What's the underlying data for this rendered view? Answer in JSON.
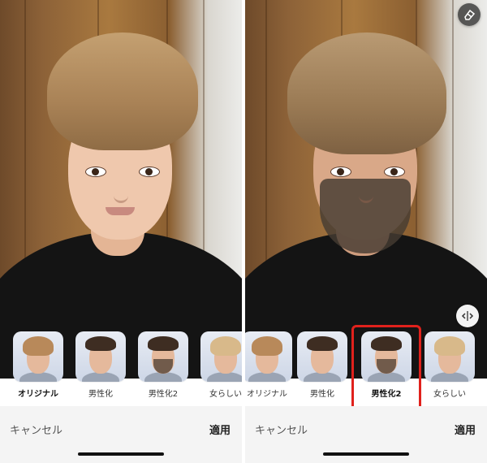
{
  "left_panel": {
    "filters": [
      {
        "label": "オリジナル",
        "selected": true
      },
      {
        "label": "男性化",
        "selected": false
      },
      {
        "label": "男性化2",
        "selected": false
      },
      {
        "label": "女らしい",
        "selected": false
      }
    ],
    "bottom_bar": {
      "cancel_label": "キャンセル",
      "apply_label": "適用"
    }
  },
  "right_panel": {
    "filters": [
      {
        "label": "オリジナル",
        "selected": false
      },
      {
        "label": "男性化",
        "selected": false
      },
      {
        "label": "男性化2",
        "selected": true
      },
      {
        "label": "女らしい",
        "selected": false
      }
    ],
    "bottom_bar": {
      "cancel_label": "キャンセル",
      "apply_label": "適用"
    },
    "icons": {
      "top_right": "eraser-icon",
      "compare": "compare-arrows-icon"
    }
  },
  "colors": {
    "highlight": "#e0211c",
    "bottom_bar": "#f4f4f4",
    "text": "#333333"
  }
}
